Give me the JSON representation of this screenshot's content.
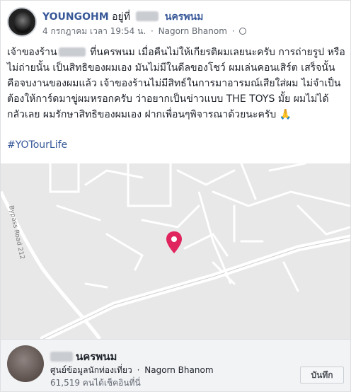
{
  "post": {
    "author": "YOUNGOHM",
    "at_word": "อยู่ที่",
    "place": "นครพนม",
    "date": "4 กรกฎาคม เวลา 19:54 น.",
    "location": "Nagorn Bhanom",
    "separator": "·",
    "body_line1_a": "เจ้าของร้าน",
    "body_line1_b": "ที่นครพนม เมื่อคืนไม่ให้เกียรติผมเลยนะครับ การถ่ายรูป",
    "body_rest": "หรือไม่ถ่ายนั้น เป็นสิทธิของผมเอง มันไม่มีในดีลของโชว์ ผมเล่นคอนเสิร์ต เสร็จนั้นคือจบงานของผมแล้ว เจ้าของร้านไม่มีสิทธ์ในการมาอารมณ์เสียใส่ผม ไม่จำเป็นต้องให้การ์ดมาขู่ผมหรอกครับ ว่าอยากเป็นข่าวแบบ THE TOYS มั้ย ผมไม่ได้กลัวเลย ผมรักษาสิทธิของผมเอง ฝากเพื่อนๆพิจารณาด้วยนะครับ 🙏",
    "hashtag": "#YOTourLife"
  },
  "map": {
    "road_label": "Bypass Road 212",
    "pin_color": "#e0245e",
    "background_color": "#e8e8e8",
    "road_color": "#ffffff"
  },
  "footer": {
    "title": "นครพนม",
    "category": "ศูนย์ข้อมูลนักท่องเที่ยว",
    "location": "Nagorn Bhanom",
    "checkins": "61,519 คนได้เช็คอินที่นี่",
    "save_label": "บันทึก"
  },
  "icons": [
    "globe-icon",
    "map-pin-icon",
    "avatar"
  ]
}
